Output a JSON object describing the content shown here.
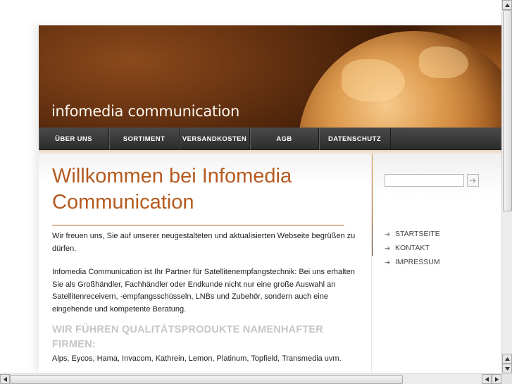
{
  "header": {
    "site_title": "infomedia communication"
  },
  "nav": {
    "items": [
      {
        "label": "ÜBER UNS"
      },
      {
        "label": "SORTIMENT"
      },
      {
        "label": "VERSANDKOSTEN"
      },
      {
        "label": "AGB"
      },
      {
        "label": "DATENSCHUTZ"
      }
    ]
  },
  "main": {
    "heading": "Willkommen bei Infomedia Communication",
    "paragraph_1": "Wir freuen uns, Sie auf unserer neugestalteten und aktualisierten Webseite begrüßen zu dürfen.",
    "paragraph_2": "Infomedia Communication ist Ihr Partner für Satellitenempfangstechnik: Bei uns erhalten Sie als Großhändler, Fachhändler oder Endkunde nicht nur eine große Auswahl an Satellitenreceivern, -empfangsschüsseln, LNBs und Zubehör, sondern auch eine eingehende und kompetente Beratung.",
    "subheading": "WIR FÜHREN QUALITÄTSPRODUKTE NAMENHAFTER FIRMEN:",
    "paragraph_3": "Alps, Eycos, Hama, Invacom, Kathrein, Lemon, Platinum, Topfield, Transmedia uvm."
  },
  "sidebar": {
    "search": {
      "value": "",
      "placeholder": ""
    },
    "links": [
      {
        "label": "STARTSEITE"
      },
      {
        "label": "KONTAKT"
      },
      {
        "label": "IMPRESSUM"
      }
    ]
  },
  "icons": {
    "search_button": "arrow-right-icon",
    "link_bullet": "arrow-bullet-icon"
  },
  "colors": {
    "accent": "#b55a1f",
    "nav_bg": "#3a3a3a",
    "subheading": "#c6c6c6"
  }
}
